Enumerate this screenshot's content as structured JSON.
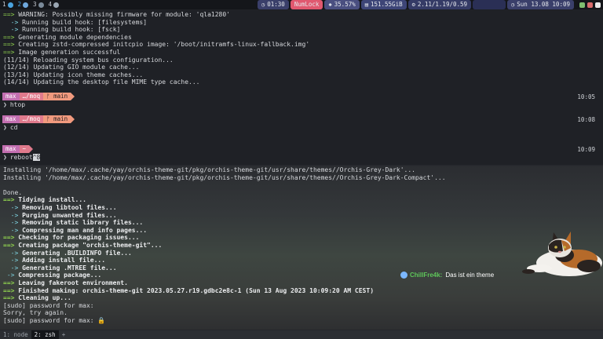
{
  "topbar": {
    "workspaces": [
      {
        "num": "1",
        "icon_color": "#4aa3df",
        "active": false
      },
      {
        "num": "2",
        "icon_color": "#6fa8dc",
        "active": true
      },
      {
        "num": "3",
        "icon_color": "#7a8a99",
        "active": false
      },
      {
        "num": "4",
        "icon_color": "#9aa6b2",
        "active": false
      }
    ],
    "modules": [
      {
        "name": "uptime-module",
        "icon": "◷",
        "text": "01:30",
        "bg": "#3a3f6a"
      },
      {
        "name": "numlock-module",
        "icon": "",
        "text": "NumLock",
        "bg": "#e0586f"
      },
      {
        "name": "cpu-module",
        "icon": "✱",
        "text": "35.57%",
        "bg": "#4a4f80"
      },
      {
        "name": "disk-module",
        "icon": "▤",
        "text": "151.55GiB",
        "bg": "#3d4577"
      },
      {
        "name": "load-module",
        "icon": "⚙",
        "text": "2.11/1.19/0.59",
        "bg": "#353b66"
      },
      {
        "name": "graph-module",
        "icon": "",
        "text": "",
        "bg": "#2a2f55"
      },
      {
        "name": "clock-module",
        "icon": "◷",
        "text": "Sun 13.08 10:09",
        "bg": "#3a3f6a"
      }
    ],
    "tray_colors": [
      "#7fbf6f",
      "#d86b6b",
      "#e8e8e8"
    ]
  },
  "term_top": {
    "lines": [
      {
        "prefix": "==> ",
        "text": "WARNING: Possibly missing firmware for module: 'qla1280'"
      },
      {
        "prefix": "  -> ",
        "text": "Running build hook: [filesystems]"
      },
      {
        "prefix": "  -> ",
        "text": "Running build hook: [fsck]"
      },
      {
        "prefix": "==> ",
        "text": "Generating module dependencies"
      },
      {
        "prefix": "==> ",
        "text": "Creating zstd-compressed initcpio image: '/boot/initramfs-linux-fallback.img'"
      },
      {
        "prefix": "==> ",
        "text": "Image generation successful"
      },
      {
        "prefix": "",
        "text": "(11/14) Reloading system bus configuration..."
      },
      {
        "prefix": "",
        "text": "(12/14) Updating GIO module cache..."
      },
      {
        "prefix": "",
        "text": "(13/14) Updating icon theme caches..."
      },
      {
        "prefix": "",
        "text": "(14/14) Updating the desktop file MIME type cache..."
      }
    ],
    "prompts": [
      {
        "user": "max",
        "path": "…/moq",
        "git": "ᚠ main",
        "time": "10:05",
        "cmd": "htop"
      },
      {
        "user": "max",
        "path": "…/moq",
        "git": "ᚠ main",
        "time": "10:08",
        "cmd": "cd"
      },
      {
        "user": "max",
        "path": "~",
        "git": "",
        "time": "10:09",
        "cmd": "reboot",
        "cursor": "^8"
      }
    ]
  },
  "term_bottom": {
    "lines": [
      {
        "kind": "plain",
        "text": "Installing '/home/max/.cache/yay/orchis-theme-git/pkg/orchis-theme-git/usr/share/themes//Orchis-Grey-Dark'..."
      },
      {
        "kind": "plain",
        "text": "Installing '/home/max/.cache/yay/orchis-theme-git/pkg/orchis-theme-git/usr/share/themes//Orchis-Grey-Dark-Compact'..."
      },
      {
        "kind": "blank",
        "text": ""
      },
      {
        "kind": "plain",
        "text": "Done."
      },
      {
        "kind": "main",
        "text": "Tidying install..."
      },
      {
        "kind": "sub",
        "text": "Removing libtool files..."
      },
      {
        "kind": "sub",
        "text": "Purging unwanted files..."
      },
      {
        "kind": "sub",
        "text": "Removing static library files..."
      },
      {
        "kind": "sub",
        "text": "Compressing man and info pages..."
      },
      {
        "kind": "main",
        "text": "Checking for packaging issues..."
      },
      {
        "kind": "main",
        "text": "Creating package \"orchis-theme-git\"..."
      },
      {
        "kind": "sub",
        "text": "Generating .BUILDINFO file..."
      },
      {
        "kind": "sub",
        "text": "Adding install file..."
      },
      {
        "kind": "sub",
        "text": "Generating .MTREE file..."
      },
      {
        "kind": "sub2",
        "text": "Compressing package..."
      },
      {
        "kind": "main",
        "text": "Leaving fakeroot environment."
      },
      {
        "kind": "main",
        "text": "Finished making: orchis-theme-git 2023.05.27.r19.gdbc2e8c-1 (Sun 13 Aug 2023 10:09:20 AM CEST)"
      },
      {
        "kind": "main",
        "text": "Cleaning up..."
      },
      {
        "kind": "plain",
        "text": "[sudo] password for max:"
      },
      {
        "kind": "plain",
        "text": "Sorry, try again."
      },
      {
        "kind": "plain",
        "text": "[sudo] password for max: 🔒"
      }
    ]
  },
  "chat": {
    "user": "ChillFre4k:",
    "message": "Das ist ein theme"
  },
  "tmux": {
    "windows": [
      {
        "label": "1: node",
        "current": false
      },
      {
        "label": "2: zsh",
        "current": true
      },
      {
        "label": "+",
        "current": false
      }
    ]
  }
}
